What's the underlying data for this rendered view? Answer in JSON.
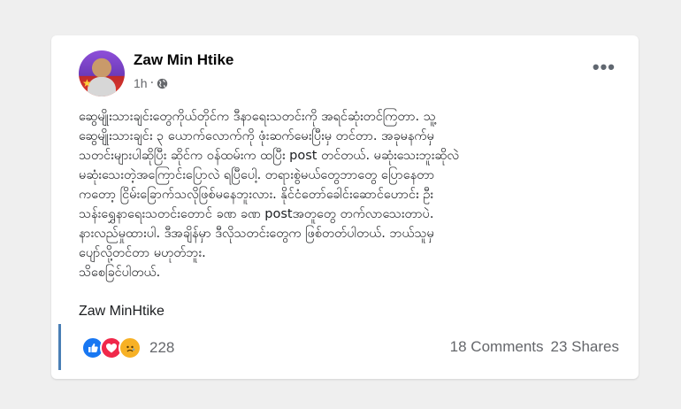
{
  "post": {
    "author": "Zaw Min Htike",
    "time": "1h",
    "separator": "·",
    "privacy_icon": "globe-icon",
    "more_icon": "•••",
    "body_lines": [
      "ဆွေမျိုးသားချင်းတွေကိုယ်တိုင်က ဒီနာရေးသတင်းကို အရင်ဆုံးတင်ကြတာ.  သူ့",
      "ဆွေမျိုးသားချင်း ၃ ယောက်လောက်ကို ဖုံးဆက်မေးပြီးမှ တင်တာ. အခုမနက်မှ",
      "သတင်းများပါဆိုပြီး ဆိုင်က ဝန်ထမ်းက ထပြီး post တင်တယ်. မဆုံးသေးဘူးဆိုလဲ",
      "မဆုံးသေးတဲ့အကြောင်းပြောလဲ ရပြီပေါ့.  တရားစွဲမယ်တွေဘာတွေ ပြောနေတာ",
      "ကတော့ ငြိမ်းခြောက်သလိုဖြစ်မနေဘူးလား.  နိုင်ငံတော်ခေါင်းဆောင်ဟောင်း ဦး",
      "သန်းရွှေနာရေးသတင်းတောင် ခဏ ခဏ postအတူတွေ တက်လာသေးတာပဲ.",
      "နားလည်မှုထားပါ. ဒီအချိန်မှာ ဒီလိုသတင်းတွေက ဖြစ်တတ်ပါတယ်. ဘယ်သူမှ",
      "ပျော်လို့တင်တာ မဟုတ်ဘူး.",
      "သိစေခြင်ပါတယ်."
    ],
    "signature": "Zaw MinHtike",
    "reactions": {
      "icons": [
        "like-icon",
        "love-icon",
        "sad-icon"
      ],
      "count": "228"
    },
    "comments": "18 Comments",
    "shares": "23 Shares"
  },
  "colors": {
    "background": "#efefef",
    "card": "#ffffff",
    "accent_bar": "#4a7fb5",
    "like": "#1877f2",
    "love": "#f0284a",
    "sad": "#f7b125"
  }
}
